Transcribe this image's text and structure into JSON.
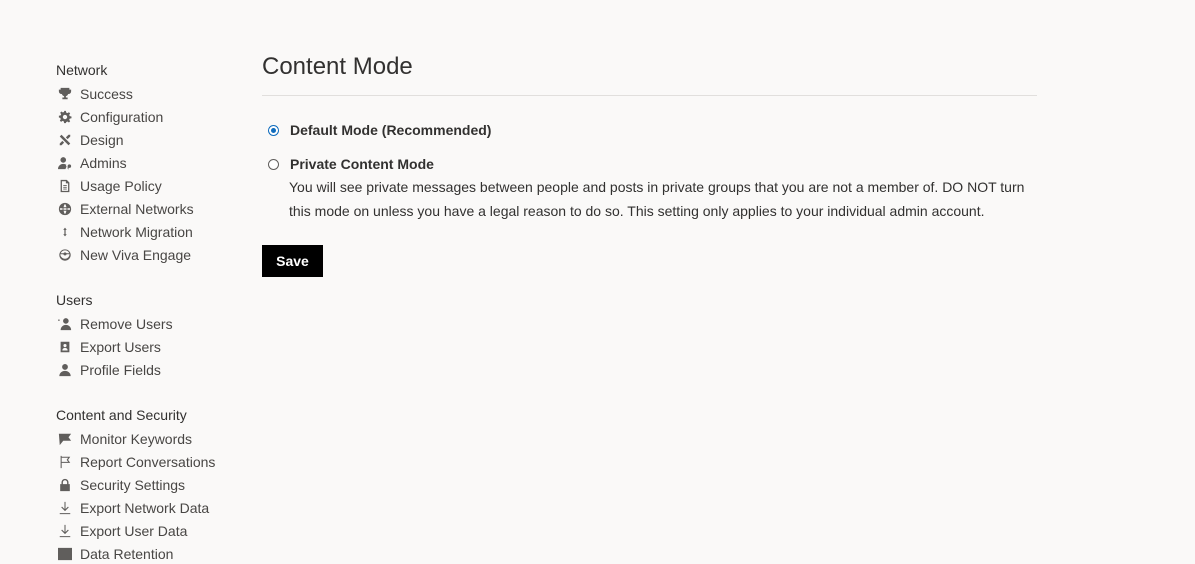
{
  "sidebar": {
    "sections": [
      {
        "title": "Network",
        "items": [
          {
            "label": "Success",
            "icon": "trophy-icon"
          },
          {
            "label": "Configuration",
            "icon": "gear-icon"
          },
          {
            "label": "Design",
            "icon": "design-icon"
          },
          {
            "label": "Admins",
            "icon": "admin-user-icon"
          },
          {
            "label": "Usage Policy",
            "icon": "document-icon"
          },
          {
            "label": "External Networks",
            "icon": "globe-icon"
          },
          {
            "label": "Network Migration",
            "icon": "arrows-vertical-icon"
          },
          {
            "label": "New Viva Engage",
            "icon": "viva-engage-icon"
          }
        ]
      },
      {
        "title": "Users",
        "items": [
          {
            "label": "Remove Users",
            "icon": "remove-user-icon"
          },
          {
            "label": "Export Users",
            "icon": "export-users-icon"
          },
          {
            "label": "Profile Fields",
            "icon": "person-icon"
          }
        ]
      },
      {
        "title": "Content and Security",
        "items": [
          {
            "label": "Monitor Keywords",
            "icon": "flag-filled-icon"
          },
          {
            "label": "Report Conversations",
            "icon": "flag-outline-icon"
          },
          {
            "label": "Security Settings",
            "icon": "lock-icon"
          },
          {
            "label": "Export Network Data",
            "icon": "download-icon"
          },
          {
            "label": "Export User Data",
            "icon": "download-icon"
          },
          {
            "label": "Data Retention",
            "icon": "data-retention-icon"
          }
        ]
      }
    ]
  },
  "main": {
    "title": "Content Mode",
    "options": [
      {
        "label": "Default Mode (Recommended)",
        "checked": true
      },
      {
        "label": "Private Content Mode",
        "checked": false
      }
    ],
    "private_description": "You will see private messages between people and posts in private groups that you are not a member of. DO NOT turn this mode on unless you have a legal reason to do so. This setting only applies to your individual admin account.",
    "save_label": "Save"
  },
  "colors": {
    "background": "#faf9f8",
    "accent": "#0f6cbd",
    "button": "#000000"
  }
}
